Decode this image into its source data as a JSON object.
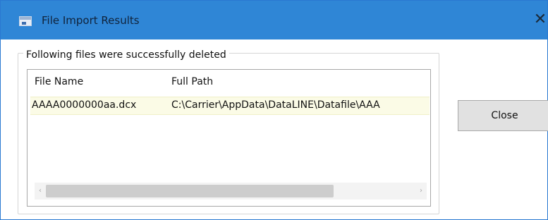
{
  "window": {
    "title": "File Import Results",
    "close_glyph": "✕"
  },
  "group": {
    "label": "Following files were successfully deleted"
  },
  "list": {
    "columns": [
      "File Name",
      "Full Path"
    ],
    "rows": [
      {
        "file_name": "AAAA0000000aa.dcx",
        "full_path": "C:\\Carrier\\AppData\\DataLINE\\Datafile\\AAA"
      }
    ]
  },
  "scrollbar": {
    "left_glyph": "‹",
    "right_glyph": "›"
  },
  "buttons": {
    "close_label": "Close"
  },
  "colors": {
    "titlebar": "#2f86d6",
    "selected_row": "#fbfbe6"
  },
  "icons": {
    "app": "app-window-icon",
    "close": "close-icon"
  }
}
